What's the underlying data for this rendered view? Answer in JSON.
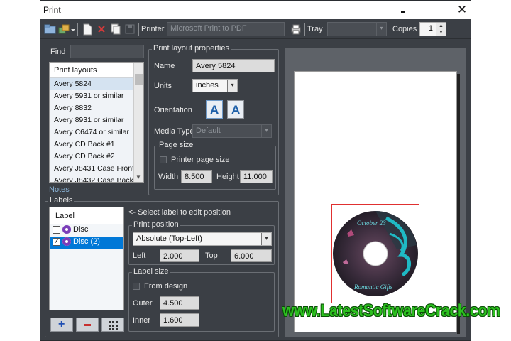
{
  "window": {
    "title": "Print"
  },
  "toolbar": {
    "printer_label": "Printer",
    "printer_value": "Microsoft Print to PDF",
    "tray_label": "Tray",
    "tray_value": "",
    "copies_label": "Copies",
    "copies_value": "1"
  },
  "find": {
    "label": "Find",
    "value": ""
  },
  "layouts": {
    "header": "Print layouts",
    "items": [
      "Avery 5824",
      "Avery 5931 or similar",
      "Avery 8832",
      "Avery 8931 or similar",
      "Avery C6474 or similar",
      "Avery CD Back #1",
      "Avery CD Back #2",
      "Avery J8431 Case Front",
      "Avery J8432 Case Back"
    ],
    "selected_index": 0
  },
  "notes_label": "Notes",
  "props": {
    "group_title": "Print layout properties",
    "name_label": "Name",
    "name_value": "Avery 5824",
    "units_label": "Units",
    "units_value": "inches",
    "orientation_label": "Orientation",
    "orientation_glyph": "A",
    "media_type_label": "Media Type",
    "media_type_value": "Default",
    "page_size_title": "Page size",
    "printer_page_size_label": "Printer page size",
    "width_label": "Width",
    "width_value": "8.500",
    "height_label": "Height",
    "height_value": "11.000"
  },
  "labels": {
    "group_title": "Labels",
    "header": "Label",
    "items": [
      {
        "name": "Disc",
        "checked": false
      },
      {
        "name": "Disc (2)",
        "checked": true
      }
    ],
    "hint": "<- Select label to edit position"
  },
  "position": {
    "group_title": "Print position",
    "mode_value": "Absolute (Top-Left)",
    "left_label": "Left",
    "left_value": "2.000",
    "top_label": "Top",
    "top_value": "6.000"
  },
  "label_size": {
    "group_title": "Label size",
    "from_design_label": "From design",
    "outer_label": "Outer",
    "outer_value": "4.500",
    "inner_label": "Inner",
    "inner_value": "1.600"
  },
  "preview": {
    "disc_title": "October 23",
    "disc_subtitle": "Romantic Gifts"
  },
  "watermark": "www.LatestSoftwareCrack.com",
  "colors": {
    "window_bg": "#3b3f45",
    "selection_bg": "#0078d7",
    "disc_ribbon": "#1fb9c4",
    "preview_frame": "#e03030",
    "watermark_green": "#2cc11f"
  }
}
